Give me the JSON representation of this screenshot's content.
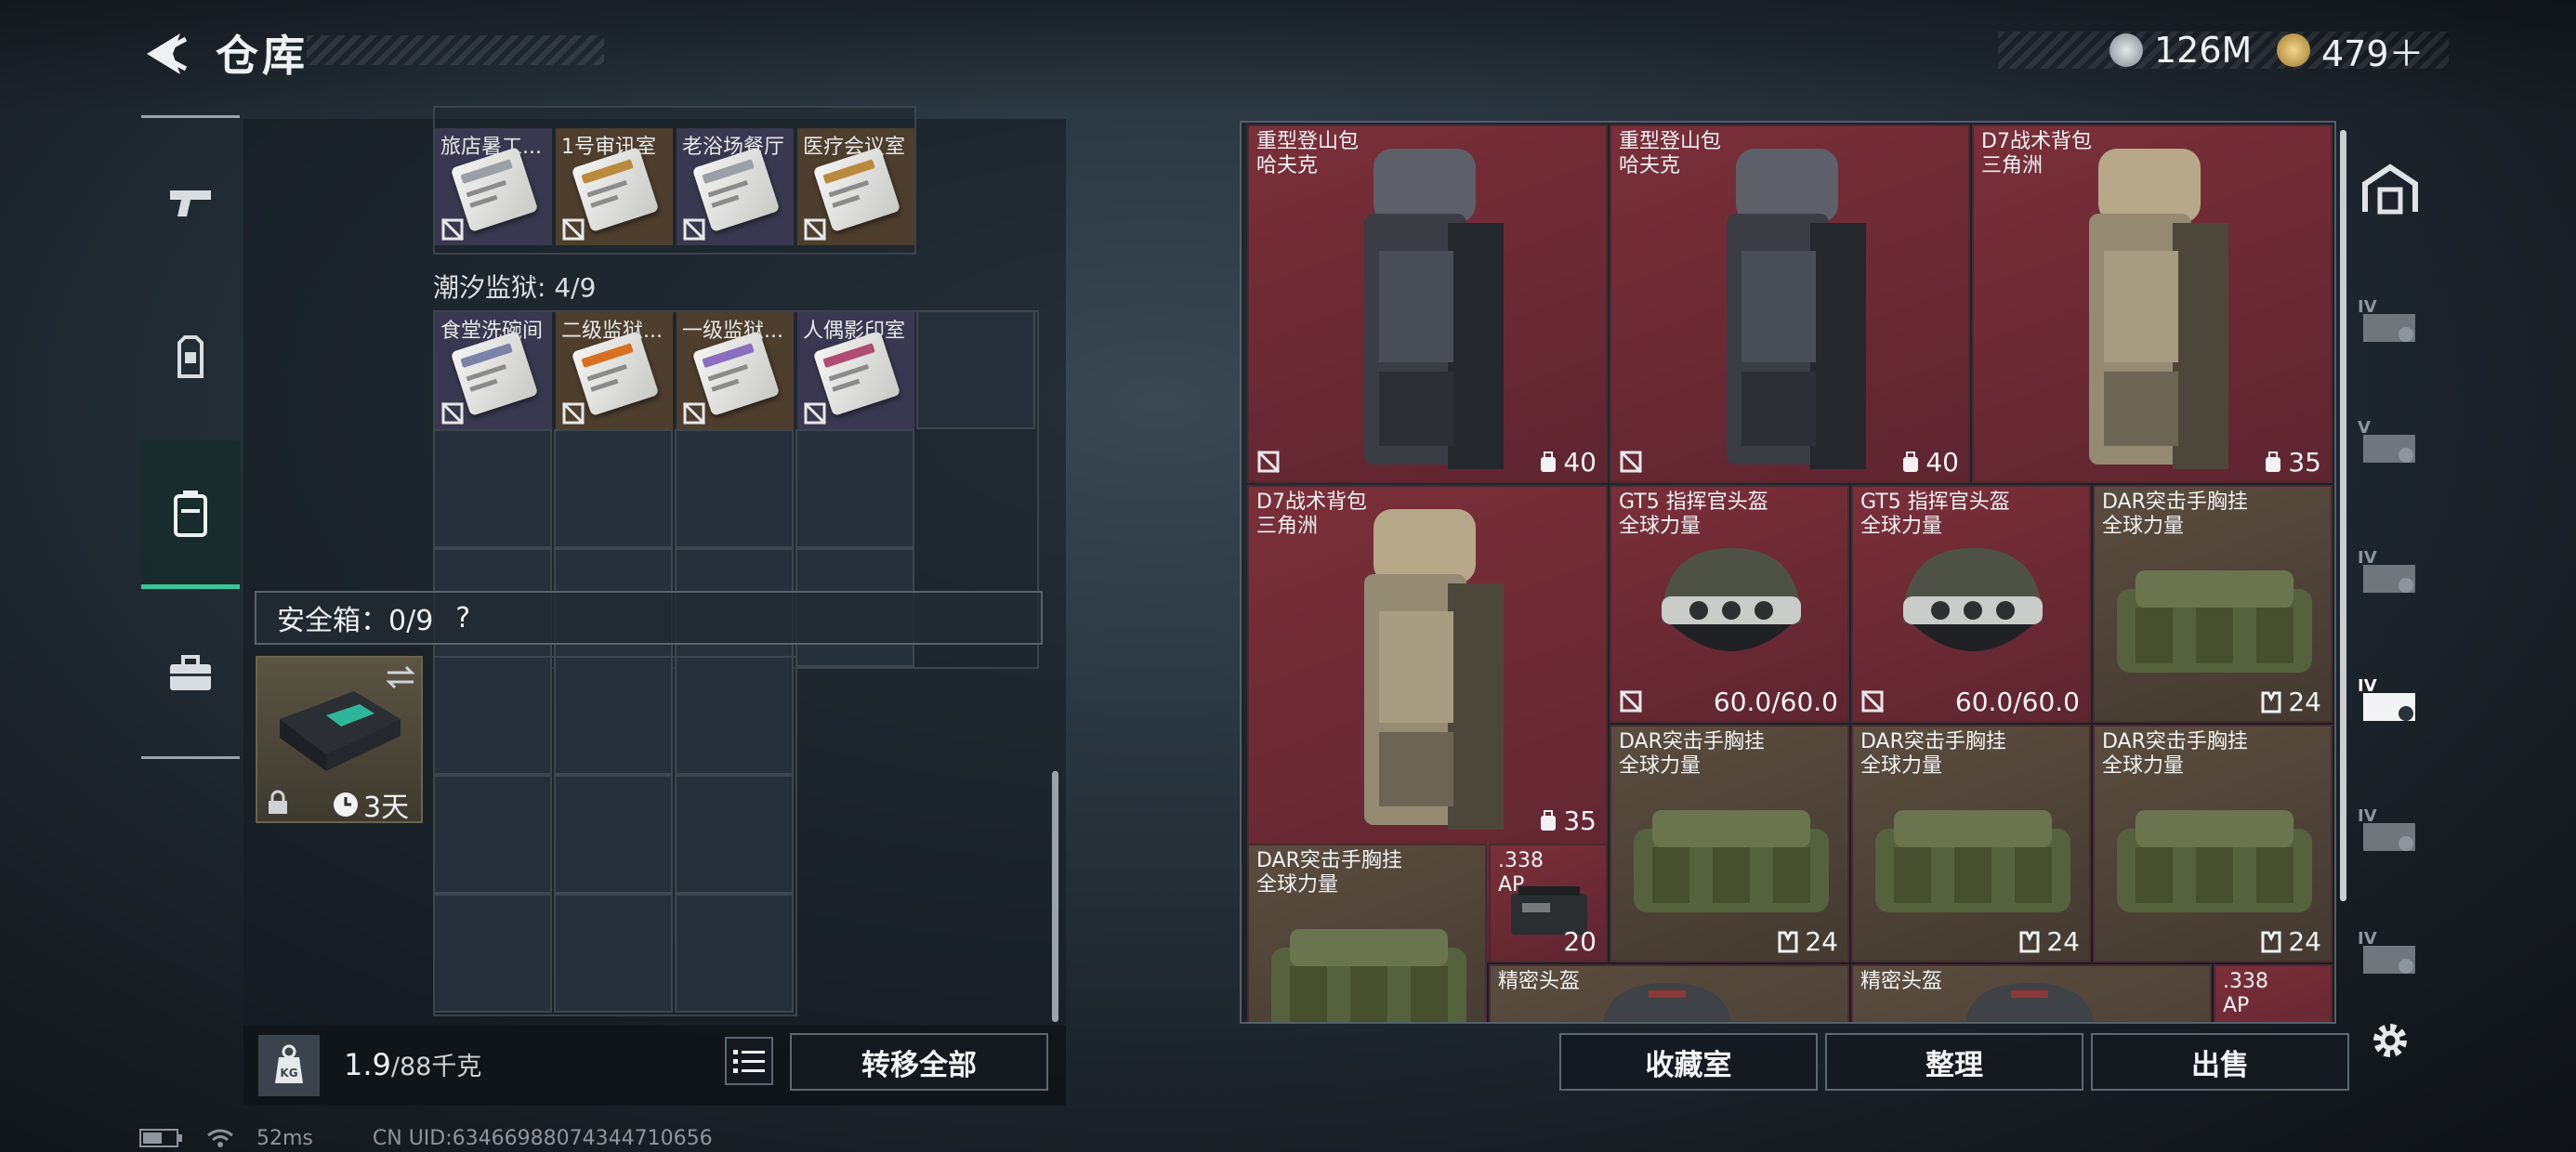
{
  "header": {
    "title": "仓库",
    "currencies": [
      {
        "name": "silver-coin-icon",
        "amount": "126M",
        "color": "#c9ced2"
      },
      {
        "name": "gold-coin-icon",
        "amount": "479＋",
        "color": "#d9b45e"
      }
    ]
  },
  "left_panel": {
    "group1": {
      "items": [
        {
          "label": "旅店暑工...",
          "accent": "#9aa0a6"
        },
        {
          "label": "1号审讯室",
          "accent": "#b98a3e"
        },
        {
          "label": "老浴场餐厅",
          "accent": "#9aa0a6"
        },
        {
          "label": "医疗会议室",
          "accent": "#b98a3e"
        }
      ]
    },
    "group2": {
      "title": "潮汐监狱: 4/9",
      "items": [
        {
          "label": "食堂洗碗间",
          "accent": "#7a82a8"
        },
        {
          "label": "二级监狱...",
          "accent": "#d9701f"
        },
        {
          "label": "一级监狱...",
          "accent": "#8a6fc1"
        },
        {
          "label": "人偶影印室",
          "accent": "#b04b72"
        }
      ]
    },
    "safe_box": {
      "label": "安全箱：0/9",
      "help": "?",
      "duration": "3天"
    },
    "weight": {
      "current": "1.9",
      "max": "/88千克"
    },
    "transfer_all": "转移全部"
  },
  "right_panel": {
    "items": [
      {
        "name": "重型登山包\n哈夫克",
        "value": "40",
        "icon": "backpack",
        "bg": "red"
      },
      {
        "name": "重型登山包\n哈夫克",
        "value": "40",
        "icon": "backpack",
        "bg": "red"
      },
      {
        "name": "D7战术背包\n三角洲",
        "value": "35",
        "icon": "backpack-tan",
        "bg": "red"
      },
      {
        "name": "D7战术背包\n三角洲",
        "value": "35",
        "icon": "backpack-tan",
        "bg": "red"
      },
      {
        "name": "GT5 指挥官头盔\n全球力量",
        "value": "60.0/60.0",
        "icon": "helmet",
        "bg": "red"
      },
      {
        "name": "GT5 指挥官头盔\n全球力量",
        "value": "60.0/60.0",
        "icon": "helmet",
        "bg": "red"
      },
      {
        "name": "DAR突击手胸挂\n全球力量",
        "value": "24",
        "icon": "vest",
        "bg": "brown"
      },
      {
        "name": "DAR突击手胸挂\n全球力量",
        "value": "24",
        "icon": "vest",
        "bg": "brown"
      },
      {
        "name": "DAR突击手胸挂\n全球力量",
        "value": "24",
        "icon": "vest",
        "bg": "brown"
      },
      {
        "name": "DAR突击手胸挂\n全球力量",
        "value": "24",
        "icon": "vest",
        "bg": "brown"
      },
      {
        "name": "DAR突击手胸挂\n全球力量",
        "value": "",
        "icon": "vest",
        "bg": "brown"
      },
      {
        "name": ".338\nAP",
        "value": "20",
        "icon": "ammo",
        "bg": "red"
      },
      {
        "name": "精密头盔",
        "value": "",
        "icon": "helmet2",
        "bg": "brown"
      },
      {
        "name": "精密头盔",
        "value": "",
        "icon": "helmet2",
        "bg": "brown"
      },
      {
        "name": ".338\nAP",
        "value": "",
        "icon": "ammo",
        "bg": "red"
      }
    ],
    "buttons": {
      "collection": "收藏室",
      "organize": "整理",
      "sell": "出售"
    }
  },
  "status": {
    "ping": "52ms",
    "uid": "CN UID:63466988074344710656"
  }
}
